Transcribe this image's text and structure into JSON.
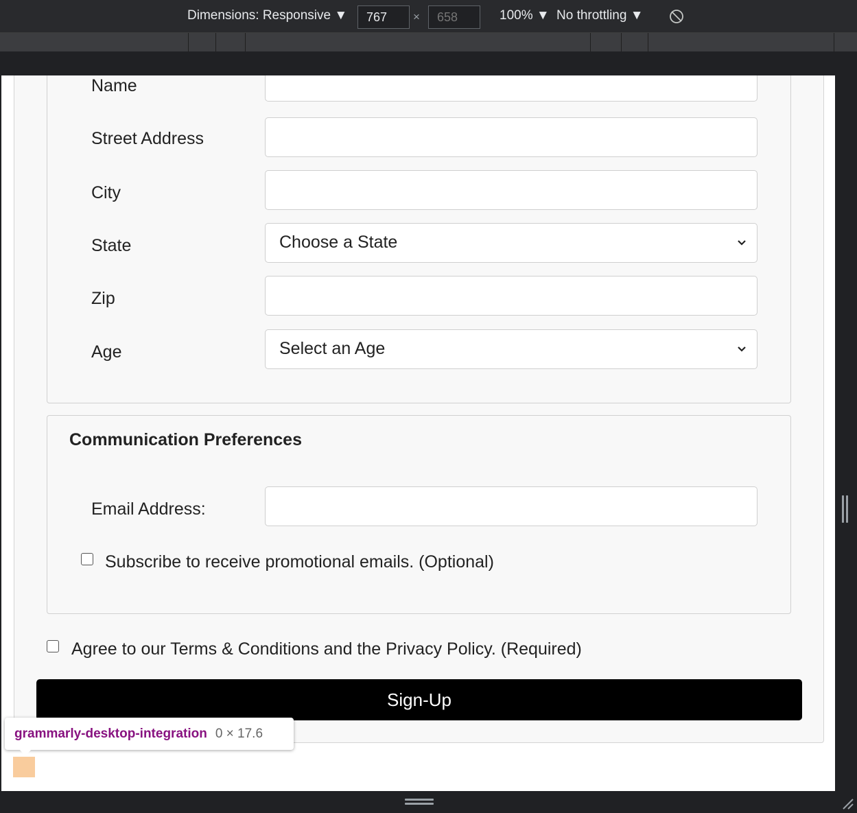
{
  "devtools": {
    "dimensions_label": "Dimensions: Responsive ▼",
    "width_value": "767",
    "times": "×",
    "height_placeholder": "658",
    "zoom_label": "100% ▼",
    "throttling_label": "No throttling ▼",
    "rotate_icon": "rotate-icon"
  },
  "form": {
    "personal": {
      "fields": [
        {
          "label": "Name"
        },
        {
          "label": "Street Address"
        },
        {
          "label": "City"
        },
        {
          "label": "State",
          "select": "Choose a State"
        },
        {
          "label": "Zip"
        },
        {
          "label": "Age",
          "select": "Select an Age"
        }
      ]
    },
    "communication": {
      "legend": "Communication Preferences",
      "email_label": "Email Address:",
      "subscribe_label": "Subscribe to receive promotional emails. (Optional)",
      "subscribe_checked": false
    },
    "terms_label": "Agree to our Terms & Conditions and the Privacy Policy. (Required)",
    "terms_checked": false,
    "signup_button": "Sign-Up"
  },
  "tooltip": {
    "element_name": "grammarly-desktop-integration",
    "dimensions": "0 × 17.6"
  },
  "colors": {
    "button_bg": "#000000",
    "tooltip_name": "#881280",
    "highlight": "#f9cc9d"
  }
}
